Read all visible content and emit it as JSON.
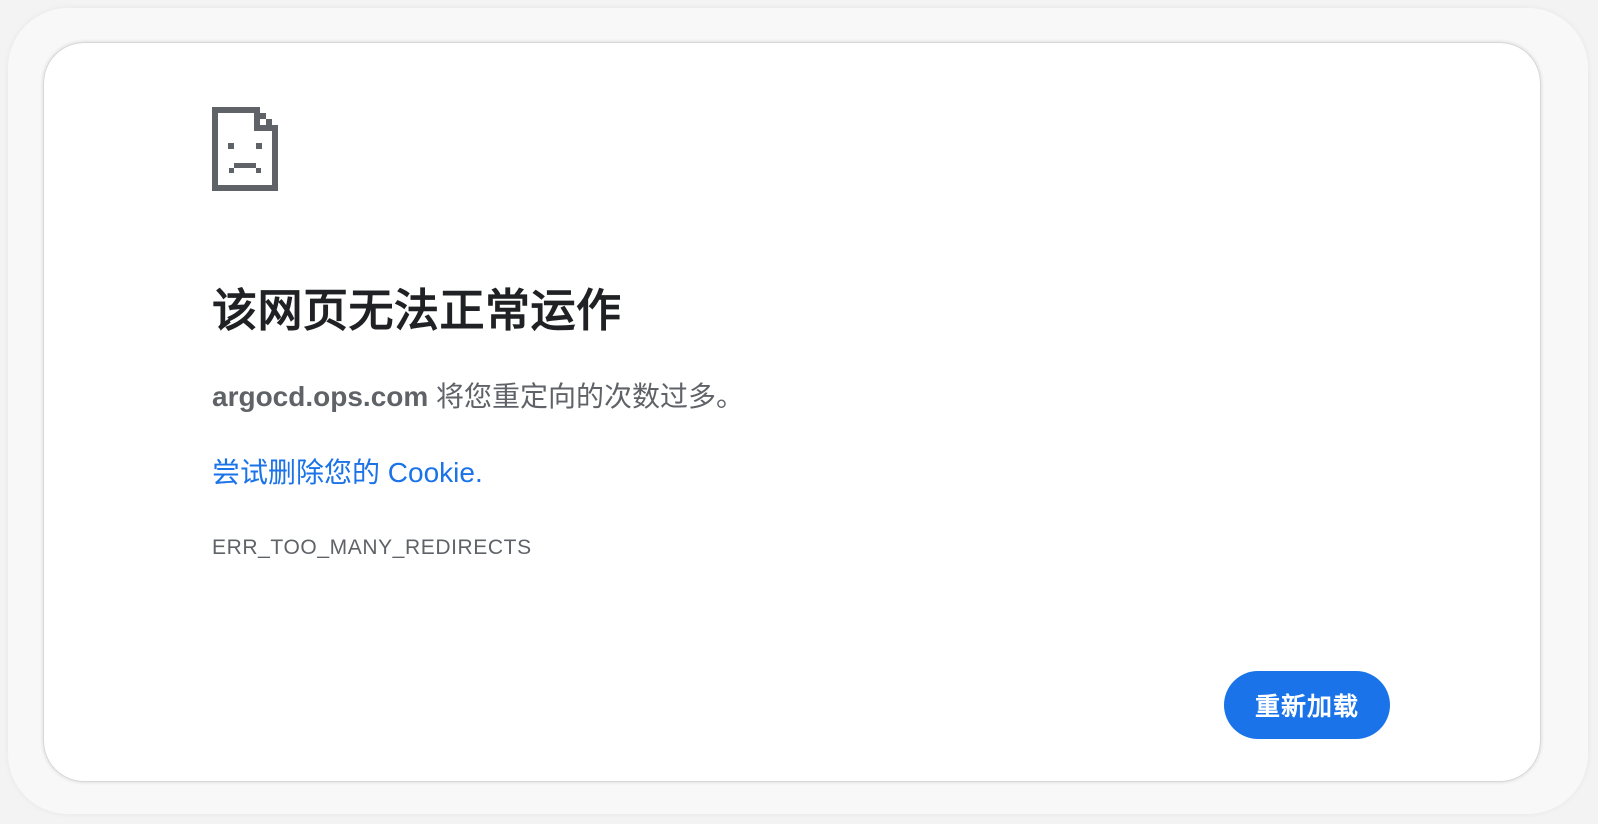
{
  "error_page": {
    "icon": "sad-page-icon",
    "title": "该网页无法正常运作",
    "message": {
      "host": "argocd.ops.com",
      "text": " 将您重定向的次数过多。"
    },
    "suggestion_link": "尝试删除您的 Cookie.",
    "error_code": "ERR_TOO_MANY_REDIRECTS",
    "reload_button": "重新加载"
  },
  "colors": {
    "accent": "#1a73e8",
    "title": "#202124",
    "body_text": "#5f6368",
    "icon": "#5f6368",
    "background": "#ffffff"
  }
}
